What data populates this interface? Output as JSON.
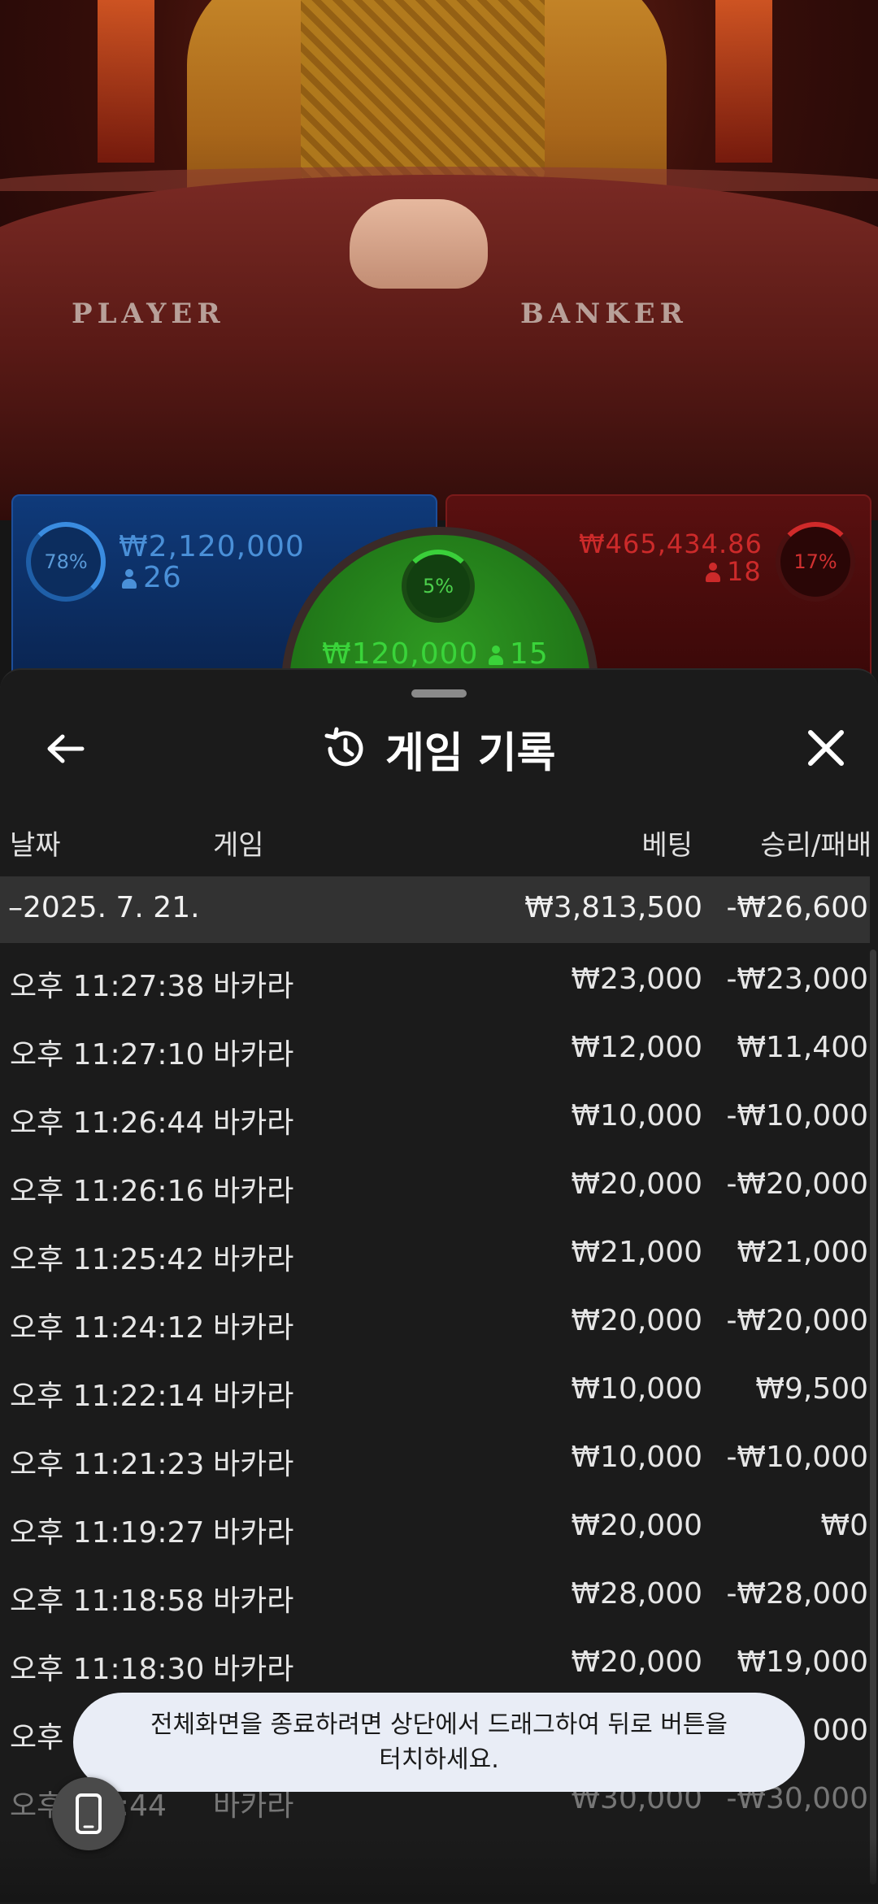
{
  "felt": {
    "player_label": "PLAYER",
    "banker_label": "BANKER"
  },
  "betting": {
    "player": {
      "percent": "78%",
      "amount": "₩2,120,000",
      "count": "26",
      "color": "#1f5fa8"
    },
    "tie": {
      "percent": "5%",
      "amount": "₩120,000",
      "count": "15",
      "color": "#2f9a22"
    },
    "banker": {
      "percent": "17%",
      "amount": "₩465,434.86",
      "count": "18",
      "color": "#cc2a2a"
    }
  },
  "sheet": {
    "title": "게임 기록",
    "icons": {
      "back": "arrow-left-icon",
      "history": "history-icon",
      "close": "close-icon"
    },
    "columns": {
      "date": "날짜",
      "game": "게임",
      "bet": "베팅",
      "result": "승리/패배"
    },
    "date_group": {
      "date": "–2025. 7. 21.",
      "bet_total": "₩3,813,500",
      "result_total": "-₩26,600"
    },
    "rows": [
      {
        "time": "오후 11:27:38",
        "game": "바카라",
        "bet": "₩23,000",
        "result": "-₩23,000"
      },
      {
        "time": "오후 11:27:10",
        "game": "바카라",
        "bet": "₩12,000",
        "result": "₩11,400"
      },
      {
        "time": "오후 11:26:44",
        "game": "바카라",
        "bet": "₩10,000",
        "result": "-₩10,000"
      },
      {
        "time": "오후 11:26:16",
        "game": "바카라",
        "bet": "₩20,000",
        "result": "-₩20,000"
      },
      {
        "time": "오후 11:25:42",
        "game": "바카라",
        "bet": "₩21,000",
        "result": "₩21,000"
      },
      {
        "time": "오후 11:24:12",
        "game": "바카라",
        "bet": "₩20,000",
        "result": "-₩20,000"
      },
      {
        "time": "오후 11:22:14",
        "game": "바카라",
        "bet": "₩10,000",
        "result": "₩9,500"
      },
      {
        "time": "오후 11:21:23",
        "game": "바카라",
        "bet": "₩10,000",
        "result": "-₩10,000"
      },
      {
        "time": "오후 11:19:27",
        "game": "바카라",
        "bet": "₩20,000",
        "result": "₩0"
      },
      {
        "time": "오후 11:18:58",
        "game": "바카라",
        "bet": "₩28,000",
        "result": "-₩28,000"
      },
      {
        "time": "오후 11:18:30",
        "game": "바카라",
        "bet": "₩20,000",
        "result": "₩19,000"
      },
      {
        "time": "오후",
        "game": "",
        "bet": "",
        "result": "000"
      },
      {
        "time": "오후 1 6:44",
        "game": "바카라",
        "bet": "₩30,000",
        "result": "-₩30,000"
      }
    ]
  },
  "toast": {
    "line1": "전체화면을 종료하려면 상단에서 드래그하여 뒤로 버튼을",
    "line2": "터치하세요."
  },
  "float_button": {
    "icon": "phone-icon"
  }
}
